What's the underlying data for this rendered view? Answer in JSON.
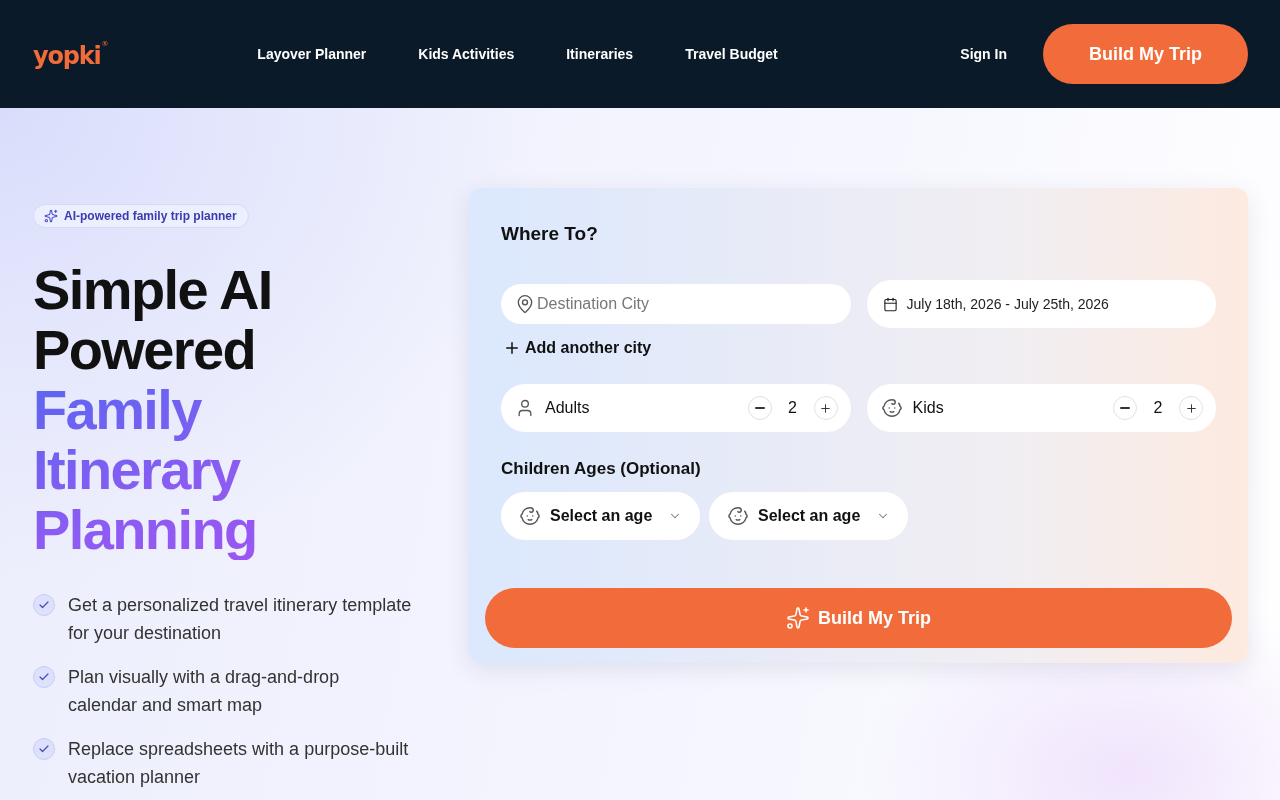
{
  "header": {
    "logo": "yopki$^{®}$",
    "nav": [
      {
        "label": "Layover Planner"
      },
      {
        "label": "Kids Activities"
      },
      {
        "label": "Itineraries"
      },
      {
        "label": "Travel Budget"
      }
    ],
    "sign_in": "Sign In",
    "cta": "Build My Trip"
  },
  "hero": {
    "badge": "AI-powered family trip planner",
    "headline": {
      "plain": "Simple AI Powered",
      "accent": "Family Itinerary Planning"
    },
    "features": [
      "Get a personalized travel itinerary template for your destination",
      "Plan visually with a drag-and-drop calendar and smart map",
      "Replace spreadsheets with a purpose-built vacation planner"
    ]
  },
  "trip_form": {
    "title": "Where To?",
    "destination": {
      "placeholder": "Destination City"
    },
    "dates": {
      "value": "July 18th, 2026 - July 25th, 2026"
    },
    "add_city": "Add another city",
    "travelers": [
      {
        "kind": "adult",
        "label": "Adults",
        "count": "2"
      },
      {
        "kind": "kid",
        "label": "Kids",
        "count": "2"
      }
    ],
    "ages_label": "Children Ages (Optional)",
    "age_selects": [
      {
        "value": "Select an age"
      },
      {
        "value": "Select an age"
      }
    ],
    "submit": "Build My Trip"
  }
}
